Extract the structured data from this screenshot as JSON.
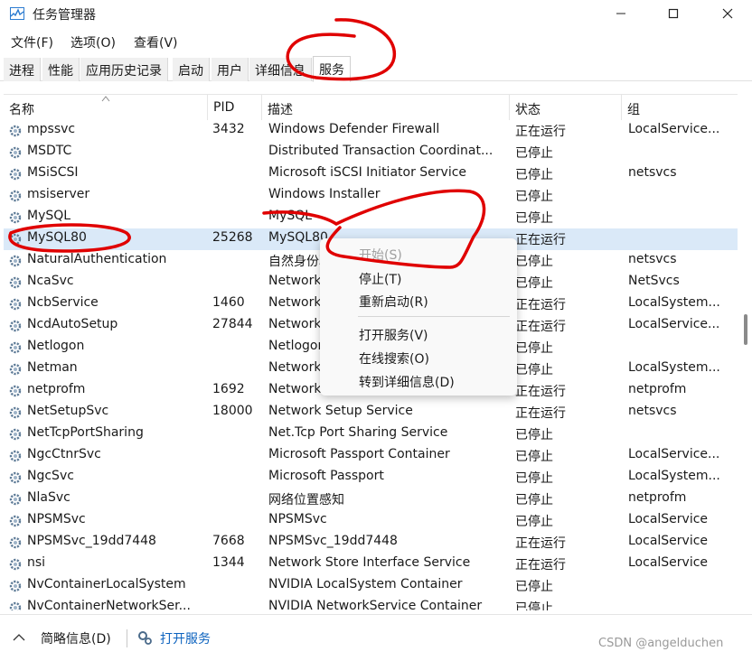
{
  "window": {
    "title": "任务管理器",
    "buttons": {
      "minimize": "minimize-icon",
      "maximize": "maximize-icon",
      "close": "close-icon"
    }
  },
  "menu": [
    "文件(F)",
    "选项(O)",
    "查看(V)"
  ],
  "tabs": [
    "进程",
    "性能",
    "应用历史记录",
    "启动",
    "用户",
    "详细信息",
    "服务"
  ],
  "active_tab": "服务",
  "columns": [
    "名称",
    "PID",
    "描述",
    "状态",
    "组"
  ],
  "rows": [
    {
      "name": "mpssvc",
      "pid": "3432",
      "desc": "Windows Defender Firewall",
      "status": "正在运行",
      "group": "LocalService..."
    },
    {
      "name": "MSDTC",
      "pid": "",
      "desc": "Distributed Transaction Coordinat...",
      "status": "已停止",
      "group": ""
    },
    {
      "name": "MSiSCSI",
      "pid": "",
      "desc": "Microsoft iSCSI Initiator Service",
      "status": "已停止",
      "group": "netsvcs"
    },
    {
      "name": "msiserver",
      "pid": "",
      "desc": "Windows Installer",
      "status": "已停止",
      "group": ""
    },
    {
      "name": "MySQL",
      "pid": "",
      "desc": "MySQL",
      "status": "已停止",
      "group": ""
    },
    {
      "name": "MySQL80",
      "pid": "25268",
      "desc": "MySQL80",
      "status": "正在运行",
      "group": ""
    },
    {
      "name": "NaturalAuthentication",
      "pid": "",
      "desc": "自然身份验证",
      "status": "已停止",
      "group": "netsvcs"
    },
    {
      "name": "NcaSvc",
      "pid": "",
      "desc": "Network Connectivity Assistant",
      "status": "已停止",
      "group": "NetSvcs"
    },
    {
      "name": "NcbService",
      "pid": "1460",
      "desc": "Network Connection Broker",
      "status": "正在运行",
      "group": "LocalSystem..."
    },
    {
      "name": "NcdAutoSetup",
      "pid": "27844",
      "desc": "Network Connected Devices Auto-Setup",
      "status": "正在运行",
      "group": "LocalService..."
    },
    {
      "name": "Netlogon",
      "pid": "",
      "desc": "Netlogon",
      "status": "已停止",
      "group": ""
    },
    {
      "name": "Netman",
      "pid": "",
      "desc": "Network Connections",
      "status": "已停止",
      "group": "LocalSystem..."
    },
    {
      "name": "netprofm",
      "pid": "1692",
      "desc": "Network List Service",
      "status": "正在运行",
      "group": "netprofm"
    },
    {
      "name": "NetSetupSvc",
      "pid": "18000",
      "desc": "Network Setup Service",
      "status": "正在运行",
      "group": "netsvcs"
    },
    {
      "name": "NetTcpPortSharing",
      "pid": "",
      "desc": "Net.Tcp Port Sharing Service",
      "status": "已停止",
      "group": ""
    },
    {
      "name": "NgcCtnrSvc",
      "pid": "",
      "desc": "Microsoft Passport Container",
      "status": "已停止",
      "group": "LocalService..."
    },
    {
      "name": "NgcSvc",
      "pid": "",
      "desc": "Microsoft Passport",
      "status": "已停止",
      "group": "LocalSystem..."
    },
    {
      "name": "NlaSvc",
      "pid": "",
      "desc": "网络位置感知",
      "status": "已停止",
      "group": "netprofm"
    },
    {
      "name": "NPSMSvc",
      "pid": "",
      "desc": "NPSMSvc",
      "status": "已停止",
      "group": "LocalService"
    },
    {
      "name": "NPSMSvc_19dd7448",
      "pid": "7668",
      "desc": "NPSMSvc_19dd7448",
      "status": "正在运行",
      "group": "LocalService"
    },
    {
      "name": "nsi",
      "pid": "1344",
      "desc": "Network Store Interface Service",
      "status": "正在运行",
      "group": "LocalService"
    },
    {
      "name": "NvContainerLocalSystem",
      "pid": "",
      "desc": "NVIDIA LocalSystem Container",
      "status": "已停止",
      "group": ""
    },
    {
      "name": "NvContainerNetworkSer...",
      "pid": "",
      "desc": "NVIDIA NetworkService Container",
      "status": "已停止",
      "group": ""
    }
  ],
  "selected_row": "MySQL80",
  "context_menu": {
    "start": "开始(S)",
    "stop": "停止(T)",
    "restart": "重新启动(R)",
    "open_services": "打开服务(V)",
    "search_online": "在线搜索(O)",
    "goto_details": "转到详细信息(D)"
  },
  "footer": {
    "less_details": "简略信息(D)",
    "open_services": "打开服务"
  },
  "watermark": "CSDN @angelduchen",
  "colors": {
    "selection": "#dae9f8",
    "link": "#0d63bf",
    "annotation": "#e00000"
  }
}
